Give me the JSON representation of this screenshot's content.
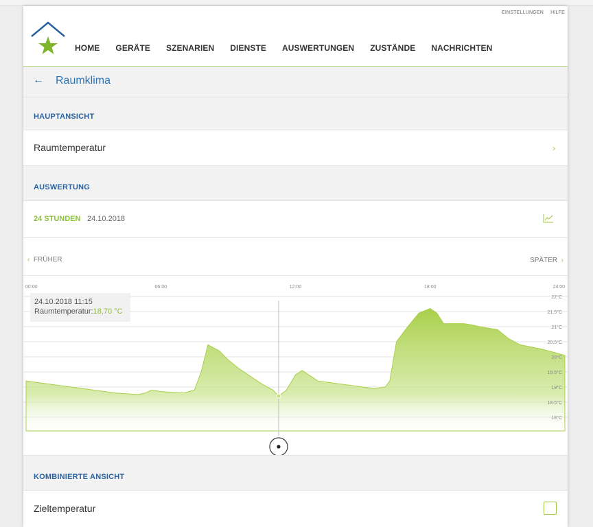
{
  "header": {
    "top_links": [
      "EINSTELLUNGEN",
      "HILFE"
    ],
    "nav": [
      "HOME",
      "GERÄTE",
      "SZENARIEN",
      "DIENSTE",
      "AUSWERTUNGEN",
      "ZUSTÄNDE",
      "NACHRICHTEN"
    ]
  },
  "page": {
    "title": "Raumklima",
    "back_icon": "arrow-left-icon"
  },
  "sections": {
    "main_view": "HAUPTANSICHT",
    "main_row": "Raumtemperatur",
    "evaluation": "AUSWERTUNG",
    "period": "24 STUNDEN",
    "date": "24.10.2018",
    "earlier": "FRÜHER",
    "later": "SPÄTER",
    "combined": "KOMBINIERTE ANSICHT",
    "combined_row": "Zieltemperatur"
  },
  "tooltip": {
    "time": "24.10.2018 11:15",
    "label": "Raumtemperatur:",
    "value": "18,70 °C"
  },
  "colors": {
    "accent": "#9bc53d",
    "blue": "#2a62a0",
    "area": "#b7d96a"
  },
  "chart_data": {
    "type": "area",
    "x_ticks": [
      "00:00",
      "06:00",
      "12:00",
      "18:00",
      "24:00"
    ],
    "y_ticks": [
      "22°C",
      "21.5°C",
      "21°C",
      "20.5°C",
      "20°C",
      "19.5°C",
      "19°C",
      "18.5°C",
      "18°C"
    ],
    "ylim": [
      18,
      22
    ],
    "xlim": [
      0,
      24
    ],
    "series": [
      {
        "x": [
          0,
          1,
          2,
          3,
          4,
          5,
          5.3,
          5.6,
          6,
          7,
          7.5,
          7.8,
          8.1,
          8.6,
          9,
          9.5,
          10,
          10.5,
          11,
          11.25,
          11.6,
          12,
          12.3,
          12.7,
          13,
          13.5,
          14,
          15,
          15.5,
          16,
          16.2,
          16.5,
          17,
          17.5,
          18,
          18.3,
          18.6,
          19,
          19.5,
          19.9,
          20.2,
          20.6,
          21,
          21.5,
          22,
          23,
          24
        ],
        "y": [
          19.2,
          19.1,
          19.0,
          18.9,
          18.8,
          18.75,
          18.8,
          18.9,
          18.85,
          18.8,
          18.9,
          19.5,
          20.4,
          20.2,
          19.9,
          19.6,
          19.35,
          19.1,
          18.9,
          18.7,
          18.9,
          19.4,
          19.55,
          19.35,
          19.2,
          19.15,
          19.1,
          19.0,
          18.95,
          19.0,
          19.2,
          20.5,
          21.0,
          21.45,
          21.6,
          21.45,
          21.1,
          21.1,
          21.1,
          21.05,
          21.0,
          20.95,
          20.9,
          20.6,
          20.4,
          20.25,
          20.05
        ]
      }
    ]
  }
}
